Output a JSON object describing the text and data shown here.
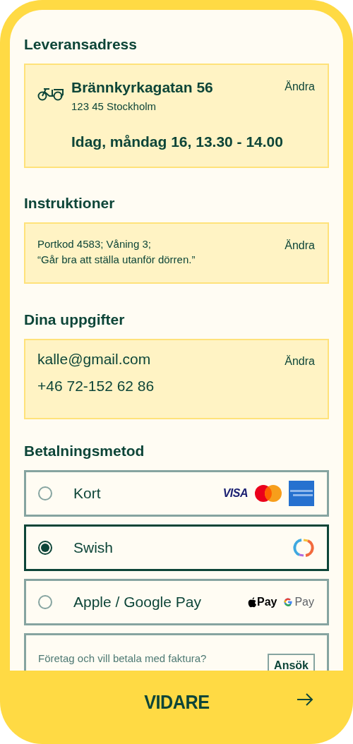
{
  "delivery": {
    "heading": "Leveransadress",
    "street": "Brännkyrkagatan 56",
    "city": "123 45 Stockholm",
    "time": "Idag, måndag 16, 13.30 - 14.00",
    "edit": "Ändra"
  },
  "instructions": {
    "heading": "Instruktioner",
    "lines": [
      "Portkod 4583; Våning 3;",
      "“Går bra att ställa utanför dörren.”"
    ],
    "edit": "Ändra"
  },
  "details": {
    "heading": "Dina uppgifter",
    "email": "kalle@gmail.com",
    "phone": "+46 72-152 62 86",
    "edit": "Ändra"
  },
  "payment": {
    "heading": "Betalningsmetod",
    "options": [
      {
        "label": "Kort",
        "selected": false,
        "logos": [
          {
            "kind": "visa",
            "text": "VISA"
          },
          {
            "kind": "mastercard"
          },
          {
            "kind": "amex"
          }
        ]
      },
      {
        "label": "Swish",
        "selected": true,
        "logos": [
          {
            "kind": "swish"
          }
        ]
      },
      {
        "label": "Apple / Google Pay",
        "selected": false,
        "logos": [
          {
            "kind": "applepay",
            "text": "Pay"
          },
          {
            "kind": "googlepay",
            "text": "Pay"
          }
        ]
      }
    ]
  },
  "invoice": {
    "lines": [
      "Företag och vill betala med faktura?"
    ],
    "button": "Ansök"
  },
  "continue_button": {
    "label": "VIDARE"
  }
}
